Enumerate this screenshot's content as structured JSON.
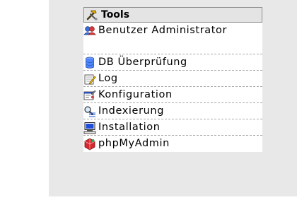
{
  "menu": {
    "title": "Tools",
    "header_icon": "hammer-wrench-icon",
    "items": [
      {
        "label": "Benutzer Administrator",
        "icon": "users-icon"
      },
      {
        "label": "DB Überprüfung",
        "icon": "database-icon"
      },
      {
        "label": "Log",
        "icon": "log-notepad-icon"
      },
      {
        "label": "Konfiguration",
        "icon": "configuration-icon"
      },
      {
        "label": "Indexierung",
        "icon": "indexing-magnifier-icon"
      },
      {
        "label": "Installation",
        "icon": "installation-computer-icon"
      },
      {
        "label": "phpMyAdmin",
        "icon": "phpmyadmin-icon"
      }
    ]
  },
  "colors": {
    "panel_bg": "#e8e8e8",
    "header_bg": "#e4e4e4",
    "separator": "#a8a8a8"
  }
}
